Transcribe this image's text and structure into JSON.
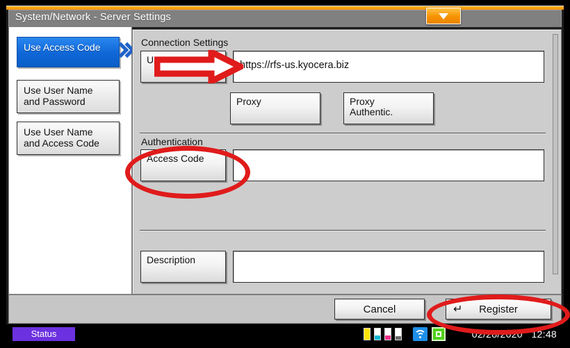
{
  "window": {
    "title": "System/Network - Server Settings",
    "collapse_icon": "chevron-down-icon"
  },
  "sidebar": {
    "items": [
      {
        "label": "Use Access Code",
        "selected": true
      },
      {
        "label": "Use User Name\nand Password",
        "selected": false
      },
      {
        "label": "Use User Name\nand Access Code",
        "selected": false
      }
    ],
    "chevron_icon": "double-chevron-right-icon"
  },
  "main": {
    "connection_group_label": "Connection Settings",
    "uri": {
      "label": "URI",
      "value": "https://rfs-us.kyocera.biz"
    },
    "proxy_button": "Proxy",
    "proxy_auth_button": "Proxy\nAuthentic.",
    "authentication_group_label": "Authentication",
    "access_code": {
      "label": "Access Code",
      "value": ""
    },
    "description": {
      "label": "Description",
      "value": ""
    }
  },
  "actions": {
    "cancel_label": "Cancel",
    "register_label": "Register",
    "register_icon": "enter-return-icon",
    "register_glyph": "↵"
  },
  "statusbar": {
    "status_label": "Status",
    "date": "02/28/2020",
    "time": "12:48",
    "icons": [
      "toner-yellow",
      "toner-cyan",
      "toner-magenta",
      "toner-black",
      "wifi-icon",
      "network-icon"
    ]
  },
  "annotations": {
    "arrow_uri": "red-right-arrow",
    "ellipse_access_code": "red-ellipse",
    "ellipse_register": "red-ellipse"
  },
  "colors": {
    "accent_orange": "#f79100",
    "selected_blue": "#0f66d6",
    "annotation_red": "#e01b1b",
    "status_purple": "#6c31e0",
    "panel_gray": "#cdcdcd",
    "titlebar_gray": "#808080"
  }
}
